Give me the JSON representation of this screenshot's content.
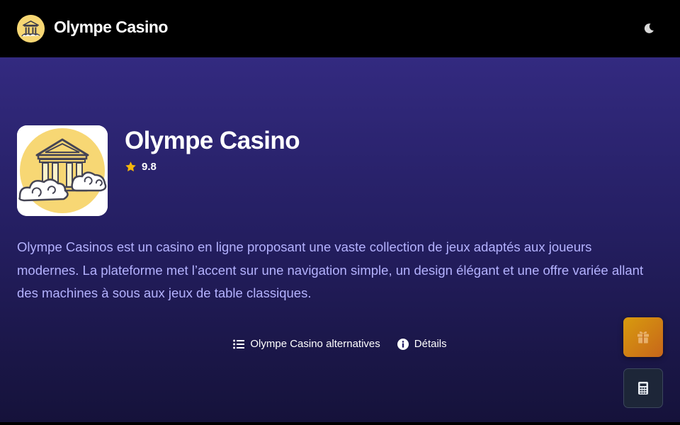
{
  "header": {
    "brand_name": "Olympe Casino",
    "logo_icon": "temple-cloud-logo",
    "theme_icon": "moon-icon"
  },
  "casino": {
    "title": "Olympe Casino",
    "rating": "9.8",
    "rating_icon": "star-icon",
    "description": "Olympe Casinos est un casino en ligne proposant une vaste collection de jeux adaptés aux joueurs modernes. La plateforme met l’accent sur une navigation simple, un design élégant et une offre variée allant des machines à sous aux jeux de table classiques."
  },
  "links": [
    {
      "label": "Olympe Casino alternatives",
      "icon": "list-icon"
    },
    {
      "label": "Détails",
      "icon": "info-icon"
    }
  ],
  "floating": {
    "gift_icon": "gift-icon",
    "calculator_icon": "calculator-icon"
  },
  "colors": {
    "accent_star": "#f5b60b",
    "description_text": "#b4b2ff",
    "hero_top": "#332a80",
    "hero_bottom": "#15123a",
    "gift_gradient_start": "#d89b0e",
    "gift_gradient_end": "#c7661a"
  }
}
